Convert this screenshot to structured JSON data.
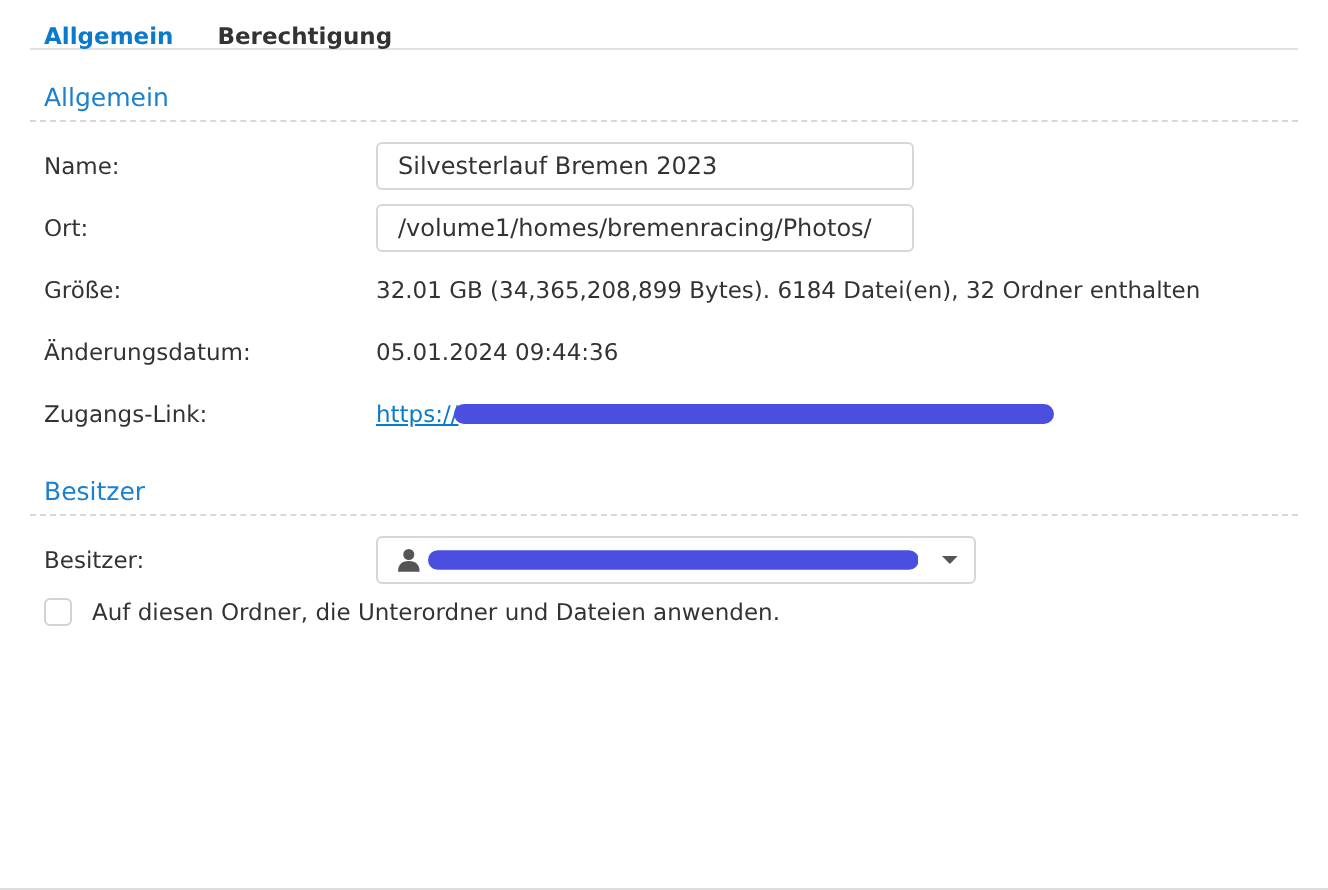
{
  "tabs": [
    {
      "label": "Allgemein",
      "selected": true
    },
    {
      "label": "Berechtigung",
      "selected": false
    }
  ],
  "sections": [
    {
      "title": "Allgemein",
      "rows": [
        {
          "kind": "field",
          "label": "Name:",
          "value": "Silvesterlauf Bremen 2023"
        },
        {
          "kind": "field",
          "label": "Ort:",
          "value": "/volume1/homes/bremenracing/Photos/"
        },
        {
          "kind": "text",
          "label": "Größe:",
          "value": "32.01 GB (34,365,208,899 Bytes). 6184 Datei(en), 32 Ordner enthalten"
        },
        {
          "kind": "text",
          "label": "Änderungsdatum:",
          "value": "05.01.2024 09:44:36"
        },
        {
          "kind": "link",
          "label": "Zugangs-Link:",
          "value": "https://"
        }
      ]
    },
    {
      "title": "Besitzer",
      "rows": [
        {
          "kind": "select",
          "label": "Besitzer:",
          "value": ""
        }
      ]
    }
  ],
  "apply_checkbox": {
    "label": "Auf diesen Ordner, die Unterordner und Dateien anwenden.",
    "checked": false
  }
}
